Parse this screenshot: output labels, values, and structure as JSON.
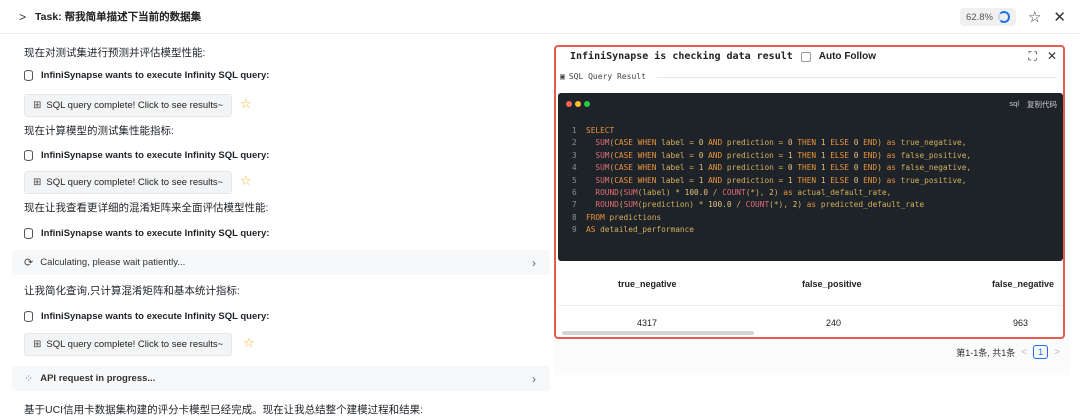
{
  "topbar": {
    "chevron": ">",
    "task": "Task: 帮我简单描述下当前的数据集",
    "progress": "62.8%",
    "star_icon": "star-outline-icon",
    "close_icon": "close-icon"
  },
  "left": {
    "p1": "现在对测试集进行预测并评估模型性能:",
    "agent1": "InfiniSynapse wants to execute Infinity SQL query:",
    "btn1": "SQL query complete! Click to see results~",
    "p2": "现在计算模型的测试集性能指标:",
    "agent2": "InfiniSynapse wants to execute Infinity SQL query:",
    "btn2": "SQL query complete! Click to see results~",
    "p3": "现在让我查看更详细的混淆矩阵来全面评估模型性能:",
    "agent3": "InfiniSynapse wants to execute Infinity SQL query:",
    "calc": "Calculating, please wait patiently...",
    "p4": "让我简化查询,只计算混淆矩阵和基本统计指标:",
    "agent4": "InfiniSynapse wants to execute Infinity SQL query:",
    "btn3": "SQL query complete! Click to see results~",
    "api": "API request in progress...",
    "p5": "基于UCI信用卡数据集构建的评分卡模型已经完成。现在让我总结整个建模过程和结果:"
  },
  "panel": {
    "title": "InfiniSynapse is checking data result",
    "auto_follow": "Auto Follow",
    "sub": "SQL Query Result",
    "lang": "sql",
    "copy": "复制代码",
    "code": [
      "SELECT",
      "  SUM(CASE WHEN label = 0 AND prediction = 0 THEN 1 ELSE 0 END) as true_negative,",
      "  SUM(CASE WHEN label = 0 AND prediction = 1 THEN 1 ELSE 0 END) as false_positive,",
      "  SUM(CASE WHEN label = 1 AND prediction = 0 THEN 1 ELSE 0 END) as false_negative,",
      "  SUM(CASE WHEN label = 1 AND prediction = 1 THEN 1 ELSE 0 END) as true_positive,",
      "  ROUND(SUM(label) * 100.0 / COUNT(*), 2) as actual_default_rate,",
      "  ROUND(SUM(prediction) * 100.0 / COUNT(*), 2) as predicted_default_rate",
      "FROM predictions",
      "AS detailed_performance"
    ],
    "columns": [
      "true_negative",
      "false_positive",
      "false_negative"
    ],
    "row": [
      "4317",
      "240",
      "963"
    ],
    "pager_text": "第1-1条, 共1条",
    "page": "1",
    "prev": "<",
    "next": ">"
  }
}
